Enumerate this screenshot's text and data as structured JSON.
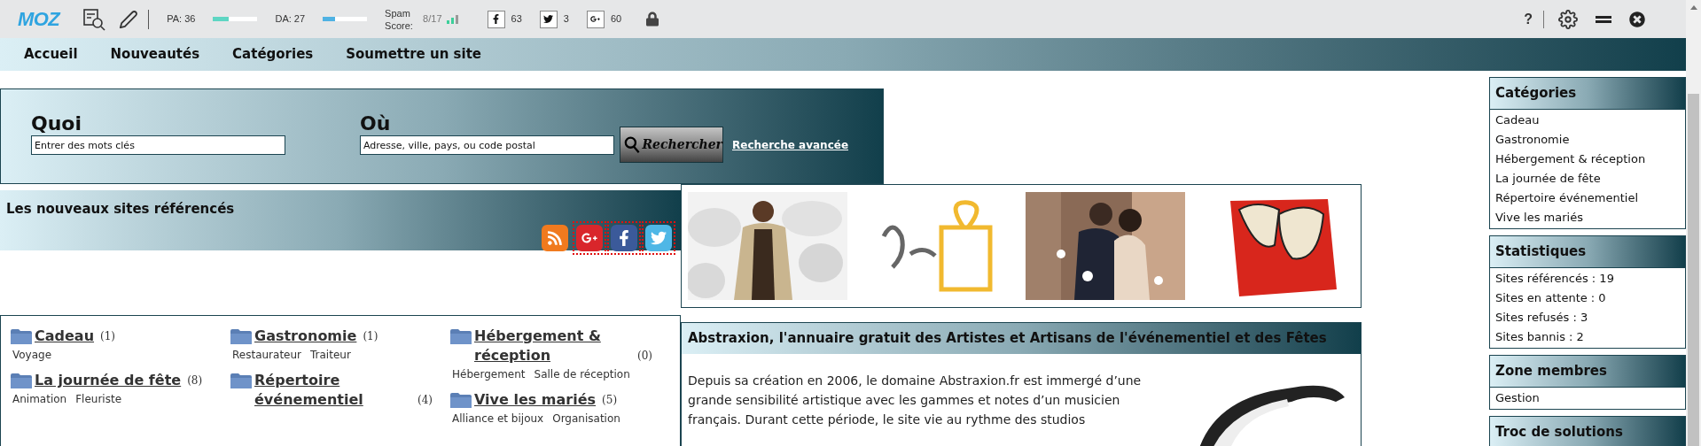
{
  "toolbar": {
    "logo": "MOZ",
    "metrics": [
      {
        "label": "PA: 36",
        "level": 0.36,
        "color": "#5ed6c3"
      },
      {
        "label": "DA: 27",
        "level": 0.27,
        "color": "#4fb2e3"
      }
    ],
    "spam": {
      "label": "Spam Score:",
      "value": "8/17"
    },
    "social": [
      {
        "kind": "facebook",
        "count": "63"
      },
      {
        "kind": "twitter",
        "count": "3"
      },
      {
        "kind": "googleplus",
        "count": "60"
      }
    ],
    "help": "?"
  },
  "nav": [
    "Accueil",
    "Nouveautés",
    "Catégories",
    "Soumettre un site"
  ],
  "search": {
    "what_label": "Quoi",
    "what_placeholder": "Entrer des mots clés",
    "where_label": "Où",
    "where_placeholder": "Adresse, ville, pays, ou code postal",
    "button": "Rechercher",
    "advanced_link": "Recherche avancée"
  },
  "new_sites": {
    "title": "Les nouveaux sites référencés",
    "feeds": [
      {
        "kind": "rss",
        "highlighted": false
      },
      {
        "kind": "googleplus",
        "highlighted": true
      },
      {
        "kind": "facebook",
        "highlighted": true
      },
      {
        "kind": "twitter",
        "highlighted": true
      }
    ]
  },
  "ads": [
    {
      "kind": "fashion"
    },
    {
      "kind": "gift"
    },
    {
      "kind": "wedding"
    },
    {
      "kind": "masks"
    }
  ],
  "categories": [
    [
      {
        "name": "Cadeau",
        "count": "(1)",
        "subs": [
          "Voyage"
        ]
      },
      {
        "name": "La journée de fête",
        "count": "(8)",
        "subs": [
          "Animation",
          "Fleuriste"
        ]
      }
    ],
    [
      {
        "name": "Gastronomie",
        "count": "(1)",
        "subs": [
          "Restaurateur",
          "Traiteur"
        ]
      },
      {
        "name": "Répertoire événementiel",
        "count": "(4)"
      }
    ],
    [
      {
        "name": "Hébergement & réception",
        "count": "(0)",
        "subs": [
          "Hébergement",
          "Salle de réception"
        ]
      },
      {
        "name": "Vive les mariés",
        "count": "(5)",
        "subs": [
          "Alliance et bijoux",
          "Organisation"
        ]
      }
    ]
  ],
  "article": {
    "title": "Abstraxion, l'annuaire gratuit des Artistes et Artisans de l'événementiel et des Fêtes",
    "body": "Depuis sa création en 2006, le domaine Abstraxion.fr est immergé d’une grande sensibilité artistique avec les gammes et notes d’un musicien français. Durant cette période, le site vie au rythme des studios"
  },
  "sidebar": [
    {
      "title": "Catégories",
      "items": [
        "Cadeau",
        "Gastronomie",
        "Hébergement & réception",
        "La journée de fête",
        "Répertoire événementiel",
        "Vive les mariés"
      ]
    },
    {
      "title": "Statistiques",
      "items": [
        "Sites référencés : 19",
        "Sites en attente : 0",
        "Sites refusés : 3",
        "Sites bannis : 2"
      ]
    },
    {
      "title": "Zone membres",
      "items": [
        "Gestion"
      ]
    },
    {
      "title": "Troc de solutions"
    }
  ]
}
